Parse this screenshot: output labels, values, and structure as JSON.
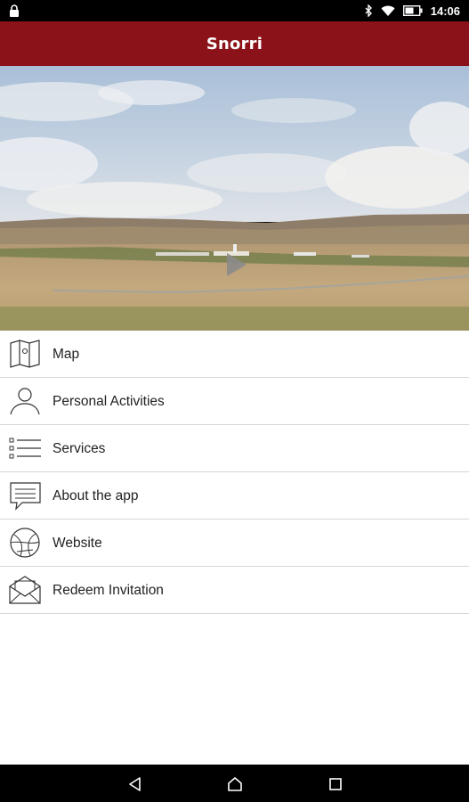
{
  "status_bar": {
    "time": "14:06",
    "icons": [
      "lock-icon",
      "bluetooth-icon",
      "wifi-icon",
      "battery-icon"
    ]
  },
  "app_bar": {
    "title": "Snorri"
  },
  "hero": {
    "media": "landscape-video-thumbnail",
    "play_icon": "play-icon"
  },
  "menu": {
    "items": [
      {
        "label": "Map",
        "icon": "map-icon"
      },
      {
        "label": "Personal Activities",
        "icon": "person-icon"
      },
      {
        "label": "Services",
        "icon": "list-icon"
      },
      {
        "label": "About the app",
        "icon": "chat-bubble-icon"
      },
      {
        "label": "Website",
        "icon": "globe-icon"
      },
      {
        "label": "Redeem Invitation",
        "icon": "envelope-icon"
      }
    ]
  },
  "nav_bar": {
    "icons": [
      "back-icon",
      "home-icon",
      "recents-icon"
    ]
  },
  "colors": {
    "app_bar": "#8a1218",
    "menu_background": "#ffffff",
    "divider": "#d6d6d6",
    "text": "#222222"
  }
}
